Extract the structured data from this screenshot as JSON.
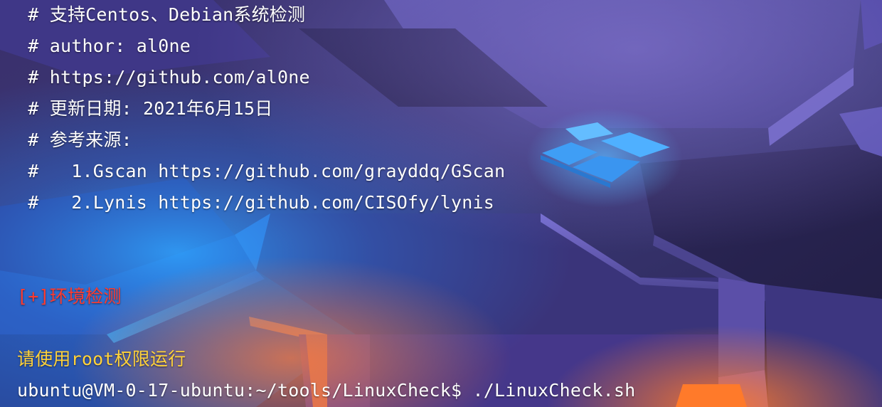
{
  "colors": {
    "comment_text": "#ffffff",
    "section_text": "#ff3b2f",
    "warning_text": "#ffd23a",
    "prompt_text": "#ffffff"
  },
  "terminal": {
    "comment_lines": [
      " # 支持Centos、Debian系统检测",
      " # author: al0ne",
      " # https://github.com/al0ne",
      " # 更新日期: 2021年6月15日",
      " # 参考来源:",
      " #   1.Gscan https://github.com/grayddq/GScan",
      " #   2.Lynis https://github.com/CISOfy/lynis"
    ],
    "section_header": "[+]环境检测",
    "warning": "请使用root权限运行",
    "prompt": "ubuntu@VM-0-17-ubuntu:~/tools/LinuxCheck$ ./LinuxCheck.sh"
  }
}
